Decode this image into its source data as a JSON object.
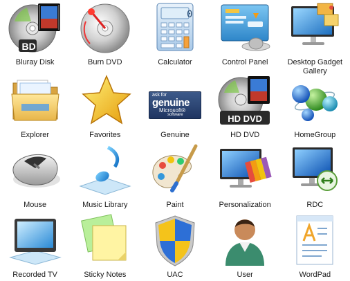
{
  "icons": [
    {
      "label": "Bluray Disk",
      "icon": "bluray-disc-icon",
      "badge": "BD"
    },
    {
      "label": "Burn DVD",
      "icon": "burn-dvd-icon"
    },
    {
      "label": "Calculator",
      "icon": "calculator-icon",
      "display": "0"
    },
    {
      "label": "Control Panel",
      "icon": "control-panel-icon"
    },
    {
      "label": "Desktop Gadget\nGallery",
      "icon": "gadget-gallery-icon"
    },
    {
      "label": "Explorer",
      "icon": "folder-icon"
    },
    {
      "label": "Favorites",
      "icon": "star-icon"
    },
    {
      "label": "Genuine",
      "icon": "genuine-icon",
      "line1": "ask for",
      "line2": "genuine",
      "line3": "Microsoft®",
      "line4": "software"
    },
    {
      "label": "HD DVD",
      "icon": "hd-dvd-icon",
      "badge": "HD DVD"
    },
    {
      "label": "HomeGroup",
      "icon": "homegroup-icon"
    },
    {
      "label": "Mouse",
      "icon": "mouse-icon"
    },
    {
      "label": "Music Library",
      "icon": "music-note-icon"
    },
    {
      "label": "Paint",
      "icon": "paint-palette-icon"
    },
    {
      "label": "Personalization",
      "icon": "personalization-icon"
    },
    {
      "label": "RDC",
      "icon": "remote-desktop-icon"
    },
    {
      "label": "Recorded TV",
      "icon": "recorded-tv-icon"
    },
    {
      "label": "Sticky Notes",
      "icon": "sticky-notes-icon"
    },
    {
      "label": "UAC",
      "icon": "uac-shield-icon"
    },
    {
      "label": "User",
      "icon": "user-icon"
    },
    {
      "label": "WordPad",
      "icon": "wordpad-icon"
    }
  ]
}
